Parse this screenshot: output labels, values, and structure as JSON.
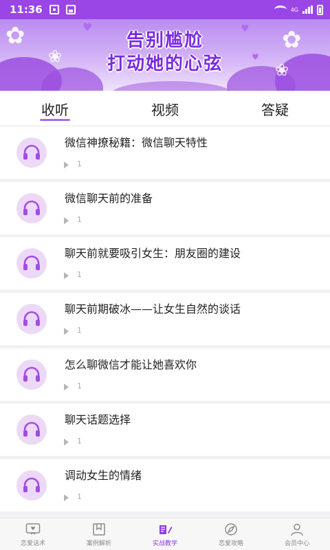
{
  "status": {
    "time": "11:36",
    "network": "4G"
  },
  "banner": {
    "line1": "告别尴尬",
    "line2": "打动她的心弦"
  },
  "tabs": [
    {
      "label": "收听",
      "active": true
    },
    {
      "label": "视频",
      "active": false
    },
    {
      "label": "答疑",
      "active": false
    }
  ],
  "items": [
    {
      "title": "微信神撩秘籍：微信聊天特性",
      "plays": "1"
    },
    {
      "title": "微信聊天前的准备",
      "plays": "1"
    },
    {
      "title": "聊天前就要吸引女生：朋友圈的建设",
      "plays": "1"
    },
    {
      "title": "聊天前期破冰——让女生自然的谈话",
      "plays": "1"
    },
    {
      "title": "怎么聊微信才能让她喜欢你",
      "plays": "1"
    },
    {
      "title": "聊天话题选择",
      "plays": "1"
    },
    {
      "title": "调动女生的情绪",
      "plays": "1"
    }
  ],
  "nav": [
    {
      "label": "恋爱话术",
      "icon": "chat-heart-icon",
      "active": false
    },
    {
      "label": "案例解析",
      "icon": "bookmark-icon",
      "active": false
    },
    {
      "label": "实战教学",
      "icon": "book-pen-icon",
      "active": true
    },
    {
      "label": "恋爱攻略",
      "icon": "compass-icon",
      "active": false
    },
    {
      "label": "会员中心",
      "icon": "user-icon",
      "active": false
    }
  ],
  "colors": {
    "accent": "#9a45e6",
    "avatar_bg": "#ecd9f7",
    "headphone": "#a24ce6"
  }
}
